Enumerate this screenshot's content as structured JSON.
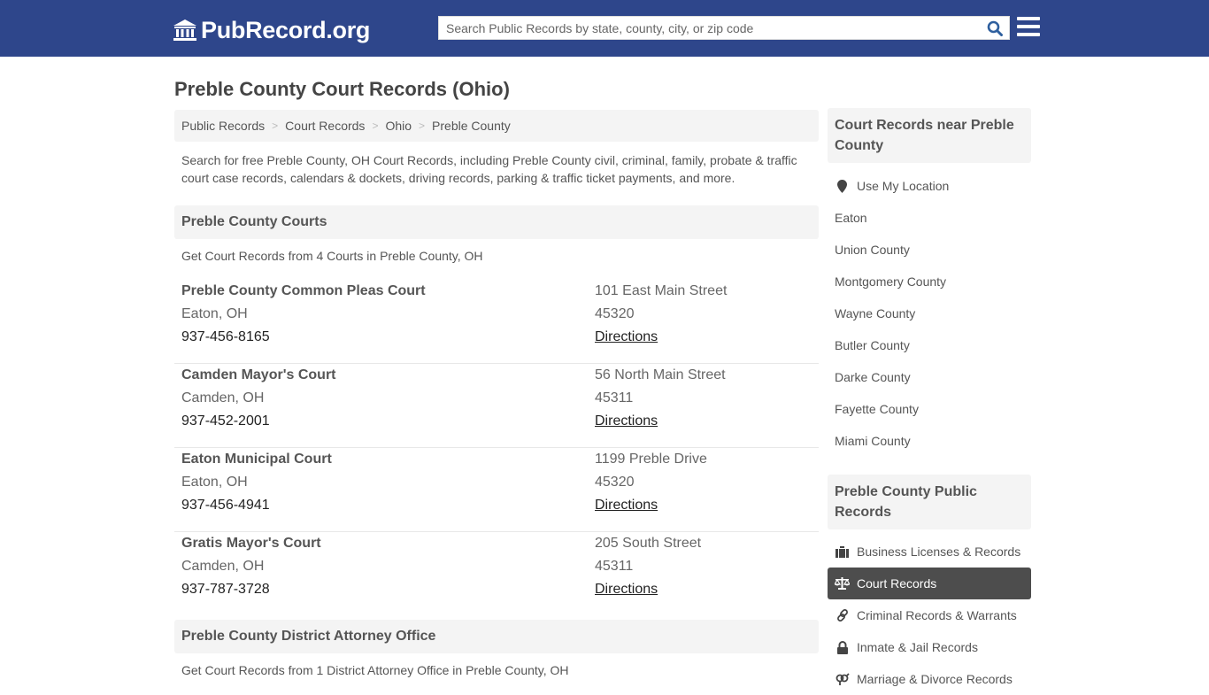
{
  "header": {
    "logo_text": "PubRecord.org",
    "search_placeholder": "Search Public Records by state, county, city, or zip code",
    "brand_color": "#2e468b"
  },
  "page": {
    "title": "Preble County Court Records (Ohio)",
    "breadcrumb": [
      "Public Records",
      "Court Records",
      "Ohio",
      "Preble County"
    ],
    "intro": "Search for free Preble County, OH Court Records, including Preble County civil, criminal, family, probate & traffic court case records, calendars & dockets, driving records, parking & traffic ticket payments, and more."
  },
  "courts_section": {
    "heading": "Preble County Courts",
    "subtitle": "Get Court Records from 4 Courts in Preble County, OH",
    "courts": [
      {
        "name": "Preble County Common Pleas Court",
        "city": "Eaton, OH",
        "phone": "937-456-8165",
        "address": "101 East Main Street",
        "zip": "45320",
        "directions": "Directions"
      },
      {
        "name": "Camden Mayor's Court",
        "city": "Camden, OH",
        "phone": "937-452-2001",
        "address": "56 North Main Street",
        "zip": "45311",
        "directions": "Directions"
      },
      {
        "name": "Eaton Municipal Court",
        "city": "Eaton, OH",
        "phone": "937-456-4941",
        "address": "1199 Preble Drive",
        "zip": "45320",
        "directions": "Directions"
      },
      {
        "name": "Gratis Mayor's Court",
        "city": "Camden, OH",
        "phone": "937-787-3728",
        "address": "205 South Street",
        "zip": "45311",
        "directions": "Directions"
      }
    ]
  },
  "da_section": {
    "heading": "Preble County District Attorney Office",
    "subtitle": "Get Court Records from 1 District Attorney Office in Preble County, OH"
  },
  "sidebar": {
    "nearby_heading": "Court Records near Preble County",
    "use_location": "Use My Location",
    "nearby": [
      "Eaton",
      "Union County",
      "Montgomery County",
      "Wayne County",
      "Butler County",
      "Darke County",
      "Fayette County",
      "Miami County"
    ],
    "public_heading": "Preble County Public Records",
    "public_items": [
      {
        "label": "Business Licenses & Records",
        "icon": "briefcase-icon"
      },
      {
        "label": "Court Records",
        "icon": "balance-scale-icon",
        "active": true
      },
      {
        "label": "Criminal Records & Warrants",
        "icon": "link-icon"
      },
      {
        "label": "Inmate & Jail Records",
        "icon": "lock-icon"
      },
      {
        "label": "Marriage & Divorce Records",
        "icon": "venus-mars-icon"
      }
    ]
  }
}
